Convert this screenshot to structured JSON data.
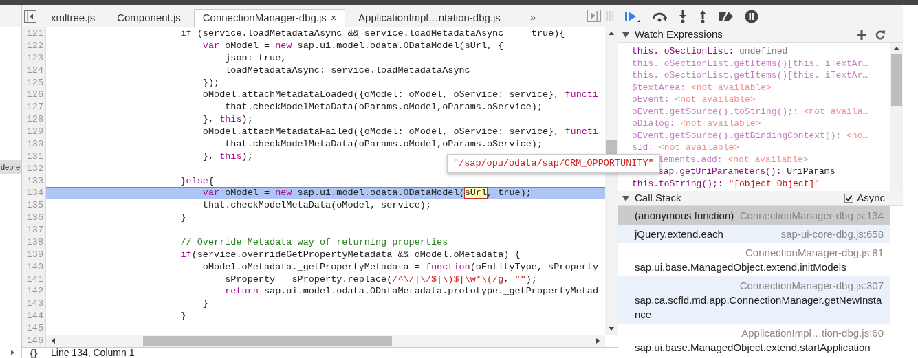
{
  "sidebar": {
    "label": "depre"
  },
  "tabs": [
    {
      "label": "xmltree.js",
      "selected": false
    },
    {
      "label": "Component.js",
      "selected": false
    },
    {
      "label": "ConnectionManager-dbg.js",
      "selected": true,
      "close_label": "×"
    },
    {
      "label": "ApplicationImpl…ntation-dbg.js",
      "selected": false
    }
  ],
  "tabs_overflow": "»",
  "code_lines": [
    {
      "number": "121",
      "current": false,
      "tokens": [
        {
          "kind": "keyword",
          "text": "                        if"
        },
        {
          "kind": "plain",
          "text": " (service.loadMetadataAsync && service.loadMetadataAsync === true){"
        }
      ]
    },
    {
      "number": "122",
      "current": false,
      "tokens": [
        {
          "kind": "keyword",
          "text": "                            var"
        },
        {
          "kind": "plain",
          "text": " oModel = "
        },
        {
          "kind": "keyword",
          "text": "new"
        },
        {
          "kind": "plain",
          "text": " sap.ui.model.odata.ODataModel(sUrl, {"
        }
      ]
    },
    {
      "number": "123",
      "current": false,
      "tokens": [
        {
          "kind": "plain",
          "text": "                                json: true,"
        }
      ]
    },
    {
      "number": "124",
      "current": false,
      "tokens": [
        {
          "kind": "plain",
          "text": "                                loadMetadataAsync: service.loadMetadataAsync"
        }
      ]
    },
    {
      "number": "125",
      "current": false,
      "tokens": [
        {
          "kind": "plain",
          "text": "                            });"
        }
      ]
    },
    {
      "number": "126",
      "current": false,
      "tokens": [
        {
          "kind": "plain",
          "text": "                            oModel.attachMetadataLoaded({oModel: oModel, oService: service}, "
        },
        {
          "kind": "keyword",
          "text": "functi"
        }
      ]
    },
    {
      "number": "127",
      "current": false,
      "tokens": [
        {
          "kind": "plain",
          "text": "                                that.checkModelMetaData(oParams.oModel,oParams.oService);"
        }
      ]
    },
    {
      "number": "128",
      "current": false,
      "tokens": [
        {
          "kind": "plain",
          "text": "                            }, "
        },
        {
          "kind": "keyword",
          "text": "this"
        },
        {
          "kind": "plain",
          "text": ");"
        }
      ]
    },
    {
      "number": "129",
      "current": false,
      "tokens": [
        {
          "kind": "plain",
          "text": "                            oModel.attachMetadataFailed({oModel: oModel, oService: service}, "
        },
        {
          "kind": "keyword",
          "text": "functi"
        }
      ]
    },
    {
      "number": "130",
      "current": false,
      "tokens": [
        {
          "kind": "plain",
          "text": "                                that.checkModelMetaData(oParams.oModel,oParams.oService);"
        }
      ]
    },
    {
      "number": "131",
      "current": false,
      "tokens": [
        {
          "kind": "plain",
          "text": "                            }, "
        },
        {
          "kind": "keyword",
          "text": "this"
        },
        {
          "kind": "plain",
          "text": ");"
        }
      ]
    },
    {
      "number": "132",
      "current": false
    },
    {
      "number": "133",
      "current": false,
      "tokens": [
        {
          "kind": "plain",
          "text": "                        }"
        },
        {
          "kind": "keyword",
          "text": "else"
        },
        {
          "kind": "plain",
          "text": "{"
        }
      ]
    },
    {
      "number": "134",
      "current": true,
      "tokens": [
        {
          "kind": "keyword",
          "text": "                            var"
        },
        {
          "kind": "plain",
          "text": " oModel = "
        },
        {
          "kind": "keyword",
          "text": "new"
        },
        {
          "kind": "plain",
          "text": " sap.ui.model.odata.ODataModel("
        },
        {
          "kind": "hovered",
          "text": "sUrl"
        },
        {
          "kind": "plain",
          "text": ", true);"
        }
      ]
    },
    {
      "number": "135",
      "current": false,
      "tokens": [
        {
          "kind": "plain",
          "text": "                            that.checkModelMetaData(oModel, service);"
        }
      ]
    },
    {
      "number": "136",
      "current": false,
      "tokens": [
        {
          "kind": "plain",
          "text": "                        }"
        }
      ]
    },
    {
      "number": "137",
      "current": false
    },
    {
      "number": "138",
      "current": false,
      "tokens": [
        {
          "kind": "comment",
          "text": "                        // Override Metadata way of returning properties"
        }
      ]
    },
    {
      "number": "139",
      "current": false,
      "tokens": [
        {
          "kind": "keyword",
          "text": "                        if"
        },
        {
          "kind": "plain",
          "text": "(service.overrideGetPropertyMetadata && oModel.oMetadata) {"
        }
      ]
    },
    {
      "number": "140",
      "current": false,
      "tokens": [
        {
          "kind": "plain",
          "text": "                            oModel.oMetadata._getPropertyMetadata = "
        },
        {
          "kind": "keyword",
          "text": "function"
        },
        {
          "kind": "plain",
          "text": "(oEntityType, sProperty"
        }
      ]
    },
    {
      "number": "141",
      "current": false,
      "tokens": [
        {
          "kind": "plain",
          "text": "                                sProperty = sProperty.replace("
        },
        {
          "kind": "string",
          "text": "/^\\/|\\/$|\\)$|\\w*\\(/g"
        },
        {
          "kind": "plain",
          "text": ", "
        },
        {
          "kind": "string",
          "text": "\"\""
        },
        {
          "kind": "plain",
          "text": ");"
        }
      ]
    },
    {
      "number": "142",
      "current": false,
      "tokens": [
        {
          "kind": "keyword",
          "text": "                                return"
        },
        {
          "kind": "plain",
          "text": " sap.ui.model.odata.ODataMetadata.prototype._getPropertyMetad"
        }
      ]
    },
    {
      "number": "143",
      "current": false,
      "tokens": [
        {
          "kind": "plain",
          "text": "                            }"
        }
      ]
    },
    {
      "number": "144",
      "current": false,
      "tokens": [
        {
          "kind": "plain",
          "text": "                        }"
        }
      ]
    },
    {
      "number": "145",
      "current": false
    },
    {
      "number": "146"
    }
  ],
  "tooltip": {
    "text": "\"/sap/opu/odata/sap/CRM_OPPORTUNITY\""
  },
  "status_bar": {
    "pretty_print": "{}",
    "position": "Line 134, Column 1"
  },
  "watch": {
    "title": "Watch Expressions",
    "items": [
      {
        "name": "this. oSectionList:",
        "value": "undefined",
        "color": "#808080",
        "in_scope": true,
        "partly_covered": false
      },
      {
        "name": "this._oSectionList.getItems()[this._iTextAr…",
        "in_scope": false,
        "partly_covered": false
      },
      {
        "name": "this. oSectionList.getItems()[this. iTextAr…",
        "in_scope": false,
        "partly_covered": false
      },
      {
        "name": "$textArea:",
        "value": "<not available>",
        "color": "#f29090",
        "in_scope": false,
        "partly_covered": false
      },
      {
        "name": "oEvent:",
        "value": "<not available>",
        "color": "#f29090",
        "in_scope": false,
        "partly_covered": false
      },
      {
        "name": "oEvent.getSource().toString();:",
        "value": "<not availa…",
        "color": "#f29090",
        "in_scope": false,
        "partly_covered": false
      },
      {
        "name": "oDialog:",
        "value": "<not available>",
        "color": "#f29090",
        "in_scope": false,
        "partly_covered": false
      },
      {
        "name": "oEvent.getSource().getBindingContext():",
        "value": "<no…",
        "color": "#f29090",
        "in_scope": false,
        "partly_covered": false
      },
      {
        "name": "sId:",
        "value": "<not available>",
        "color": "#f29090",
        "in_scope": false,
        "partly_covered": false
      },
      {
        "name": "lements.add:",
        "value": "<not available>",
        "color": "#f29090",
        "in_scope": false,
        "partly_covered": true
      },
      {
        "name": "sap.getUriParameters():",
        "value": "UriParams",
        "color": "#222222",
        "in_scope": true,
        "partly_covered": true
      },
      {
        "name": "this.toString();:",
        "value": "\"[object Object]\"",
        "color": "#c41a16",
        "in_scope": true,
        "partly_covered": false
      }
    ]
  },
  "call_stack": {
    "title": "Call Stack",
    "async": {
      "label": "Async",
      "checked": true
    },
    "frames": [
      {
        "function": "(anonymous function)",
        "location": "ConnectionManager-dbg.js:134",
        "selected": true,
        "kind": "inline"
      },
      {
        "function": "jQuery.extend.each",
        "location": "sap-ui-core-dbg.js:658",
        "selected": false,
        "kind": "inline"
      },
      {
        "function": "sap.ui.base.ManagedObject.extend.initModels",
        "location": "ConnectionManager-dbg.js:81",
        "selected": false,
        "kind": "wrapped"
      },
      {
        "function": "sap.ca.scfld.md.app.ConnectionManager.getNewInstance",
        "location": "ConnectionManager-dbg.js:307",
        "selected": false,
        "kind": "wrapped"
      },
      {
        "function": "sap.ui.base.ManagedObject.extend.startApplication",
        "location": "ApplicationImpl…tion-dbg.js:60",
        "selected": false,
        "kind": "wrapped"
      }
    ]
  }
}
